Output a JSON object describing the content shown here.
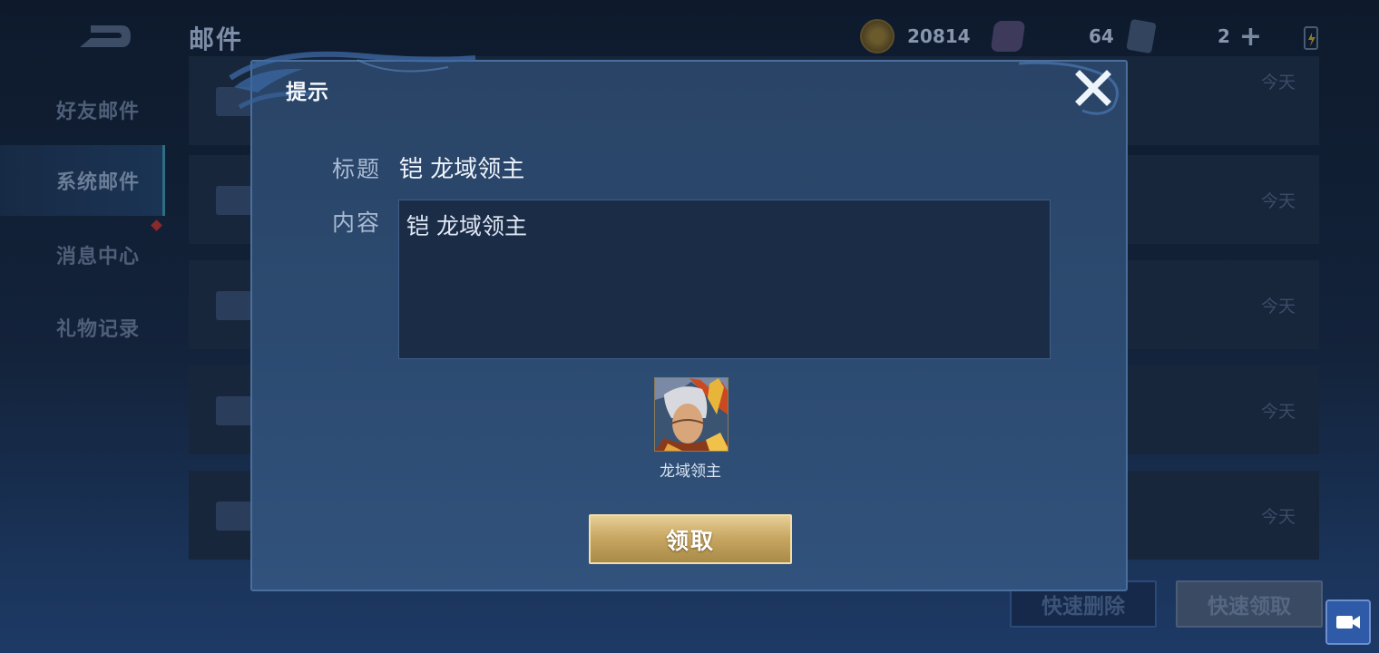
{
  "page": {
    "title": "邮件"
  },
  "resources": [
    {
      "icon": "gold-coin-icon",
      "value": "20814"
    },
    {
      "icon": "diamond-icon",
      "value": "64"
    },
    {
      "icon": "ticket-icon",
      "value": "2"
    }
  ],
  "sidebar": {
    "items": [
      {
        "label": "好友邮件"
      },
      {
        "label": "系统邮件"
      },
      {
        "label": "消息中心"
      },
      {
        "label": "礼物记录"
      }
    ]
  },
  "mail_list": [
    {
      "date": "今天"
    },
    {
      "date": "今天"
    },
    {
      "date": "今天"
    },
    {
      "date": "今天"
    },
    {
      "date": "今天"
    }
  ],
  "actions": {
    "delete_all": "快速删除",
    "claim_all": "快速领取"
  },
  "modal": {
    "title": "提示",
    "subject_label": "标题",
    "subject_value": "铠 龙域领主",
    "content_label": "内容",
    "content_value": "铠 龙域领主",
    "reward_name": "龙域领主",
    "claim_label": "领取"
  },
  "colors": {
    "accent_gold": "#c9a863",
    "modal_bg": "#2c4a70"
  }
}
